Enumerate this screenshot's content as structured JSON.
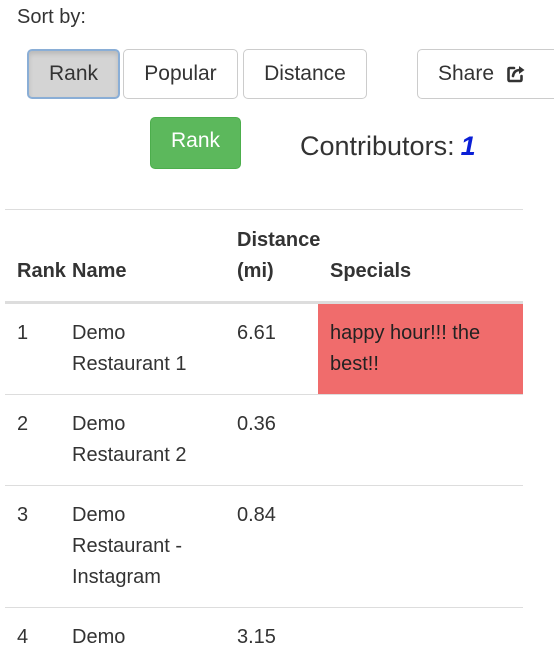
{
  "sort": {
    "label": "Sort by:",
    "buttons": [
      {
        "label": "Rank",
        "active": true
      },
      {
        "label": "Popular",
        "active": false
      },
      {
        "label": "Distance",
        "active": false
      }
    ],
    "share_label": "Share"
  },
  "rank_button_label": "Rank",
  "contributors": {
    "label": "Contributors:",
    "count": "1"
  },
  "colors": {
    "accent_green": "#5cb85c",
    "special_highlight": "#f06c6c",
    "contributor_count": "#0a1fd6"
  },
  "table": {
    "headers": {
      "rank": "Rank",
      "name": "Name",
      "distance": "Distance (mi)",
      "specials": "Specials"
    },
    "rows": [
      {
        "rank": "1",
        "name": "Demo Restaurant 1",
        "distance": "6.61",
        "specials": "happy hour!!! the best!!",
        "highlight": true
      },
      {
        "rank": "2",
        "name": "Demo Restaurant 2",
        "distance": "0.36",
        "specials": "",
        "highlight": false
      },
      {
        "rank": "3",
        "name": "Demo Restaurant - Instagram",
        "distance": "0.84",
        "specials": "",
        "highlight": false
      },
      {
        "rank": "4",
        "name": "Demo",
        "distance": "3.15",
        "specials": "",
        "highlight": false
      }
    ]
  },
  "icons": {
    "share": "share-external-icon"
  }
}
